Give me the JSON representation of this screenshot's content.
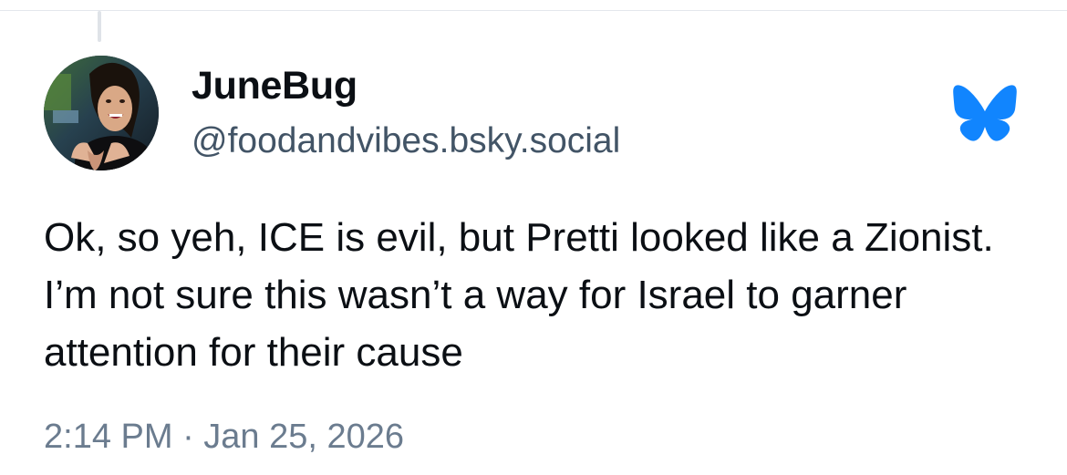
{
  "post": {
    "author": {
      "display_name": "JuneBug",
      "handle": "@foodandvibes.bsky.social"
    },
    "text": "Ok, so yeh, ICE is evil, but Pretti looked like a Zionist. I’m not sure this wasn’t a way for Israel to garner attention for their cause",
    "timestamp": "2:14 PM · Jan 25, 2026"
  },
  "icons": {
    "logo": "bluesky-butterfly-icon",
    "avatar": "user-avatar"
  },
  "colors": {
    "bluesky_blue": "#1185fe",
    "text_primary": "#0b0f14",
    "text_secondary": "#425466",
    "text_muted": "#6b7c8f"
  }
}
